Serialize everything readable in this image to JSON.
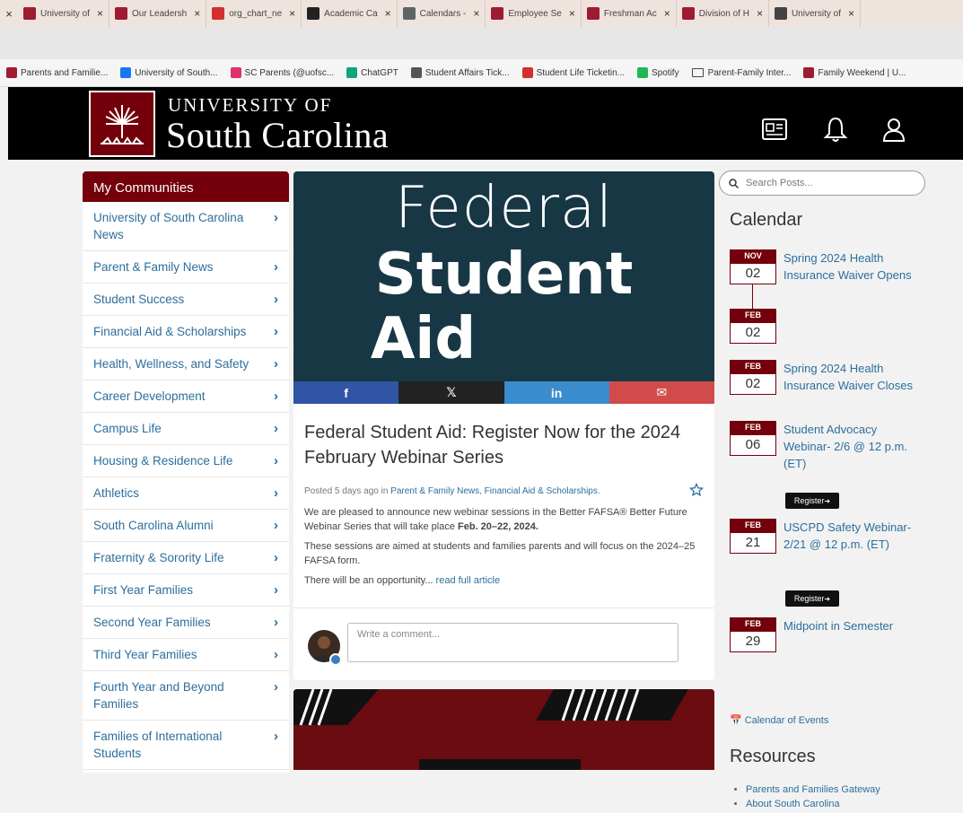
{
  "browser": {
    "tabs": [
      {
        "title": "University of",
        "color": "#9e1b32"
      },
      {
        "title": "Our Leadersh",
        "color": "#9e1b32"
      },
      {
        "title": "org_chart_ne",
        "color": "#d32f2f"
      },
      {
        "title": "Academic Ca",
        "color": "#222222"
      },
      {
        "title": "Calendars -",
        "color": "#5f6368"
      },
      {
        "title": "Employee Se",
        "color": "#9e1b32"
      },
      {
        "title": "Freshman Ac",
        "color": "#9e1b32"
      },
      {
        "title": "Division of H",
        "color": "#9e1b32"
      },
      {
        "title": "University of",
        "color": "#444444"
      }
    ],
    "bookmarks": [
      {
        "label": "Parents and Familie...",
        "color": "#9e1b32",
        "type": "site"
      },
      {
        "label": "University of South...",
        "color": "#1877f2",
        "type": "site"
      },
      {
        "label": "SC Parents (@uofsc...",
        "color": "#e1306c",
        "type": "site"
      },
      {
        "label": "ChatGPT",
        "color": "#10a37f",
        "type": "site"
      },
      {
        "label": "Student Affairs Tick...",
        "color": "#555555",
        "type": "site"
      },
      {
        "label": "Student Life Ticketin...",
        "color": "#d32f2f",
        "type": "site"
      },
      {
        "label": "Spotify",
        "color": "#1db954",
        "type": "site"
      },
      {
        "label": "Parent-Family Inter...",
        "color": "#444444",
        "type": "folder"
      },
      {
        "label": "Family Weekend | U...",
        "color": "#9e1b32",
        "type": "site"
      }
    ]
  },
  "header": {
    "line1": "UNIVERSITY OF",
    "line2": "South Carolina",
    "icons": [
      "newspaper-icon",
      "bell-icon",
      "user-icon"
    ]
  },
  "sidebar": {
    "title": "My Communities",
    "items": [
      {
        "label": "University of South Carolina News"
      },
      {
        "label": "Parent & Family News"
      },
      {
        "label": "Student Success"
      },
      {
        "label": "Financial Aid & Scholarships"
      },
      {
        "label": "Health, Wellness, and Safety"
      },
      {
        "label": "Career Development"
      },
      {
        "label": "Campus Life"
      },
      {
        "label": "Housing & Residence Life"
      },
      {
        "label": "Athletics"
      },
      {
        "label": "South Carolina Alumni"
      },
      {
        "label": "Fraternity & Sorority Life"
      },
      {
        "label": "First Year Families"
      },
      {
        "label": "Second Year Families"
      },
      {
        "label": "Third Year Families"
      },
      {
        "label": "Fourth Year and Beyond Families"
      },
      {
        "label": "Families of International Students"
      }
    ]
  },
  "post": {
    "hero": {
      "line1": "Federal",
      "line2": "Student",
      "line3": "Aid"
    },
    "share": [
      {
        "icon": "facebook-icon",
        "glyph": "f",
        "color": "#2f55a4"
      },
      {
        "icon": "x-icon",
        "glyph": "𝕏",
        "color": "#222222"
      },
      {
        "icon": "linkedin-icon",
        "glyph": "in",
        "color": "#3b8ccc"
      },
      {
        "icon": "email-icon",
        "glyph": "✉",
        "color": "#d24b4b"
      }
    ],
    "title": "Federal Student Aid: Register Now for the 2024 February Webinar Series",
    "meta_prefix": "Posted 5 days ago in",
    "meta_cat1": "Parent & Family News",
    "meta_cat2": "Financial Aid & Scholarships",
    "para1_text": "We are pleased to announce new webinar sessions in the Better FAFSA® Better Future Webinar Series that will take place",
    "para1_bold": "Feb. 20–22, 2024.",
    "para2": "These sessions are aimed at students and families parents and will focus on the 2024–25 FAFSA form.",
    "para3_text": "There will be an opportunity...",
    "para3_link": "read full article",
    "comment_placeholder": "Write a comment..."
  },
  "search": {
    "placeholder": "Search Posts..."
  },
  "calendar": {
    "title": "Calendar",
    "events": [
      {
        "month": "NOV",
        "day": "02",
        "title": "Spring 2024 Health Insurance Waiver Opens"
      },
      {
        "month": "FEB",
        "day": "02",
        "title": ""
      },
      {
        "month": "FEB",
        "day": "02",
        "title": "Spring 2024 Health Insurance Waiver Closes"
      },
      {
        "month": "FEB",
        "day": "06",
        "title": "Student Advocacy Webinar- 2/6 @ 12 p.m. (ET)",
        "button": "Register"
      },
      {
        "month": "FEB",
        "day": "21",
        "title": "USCPD Safety Webinar- 2/21 @ 12 p.m. (ET)",
        "button": "Register"
      },
      {
        "month": "FEB",
        "day": "29",
        "title": "Midpoint in Semester"
      }
    ],
    "link": "Calendar of Events"
  },
  "resources": {
    "title": "Resources",
    "items": [
      "Parents and Families Gateway",
      "About South Carolina"
    ]
  }
}
